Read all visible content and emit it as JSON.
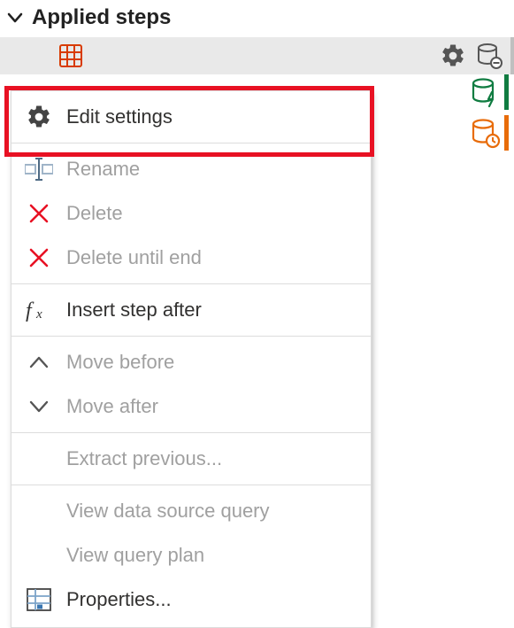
{
  "panel": {
    "title": "Applied steps"
  },
  "menu": {
    "edit_settings": "Edit settings",
    "rename": "Rename",
    "delete": "Delete",
    "delete_until_end": "Delete until end",
    "insert_step_after": "Insert step after",
    "move_before": "Move before",
    "move_after": "Move after",
    "extract_previous": "Extract previous...",
    "view_data_source_query": "View data source query",
    "view_query_plan": "View query plan",
    "properties": "Properties..."
  }
}
